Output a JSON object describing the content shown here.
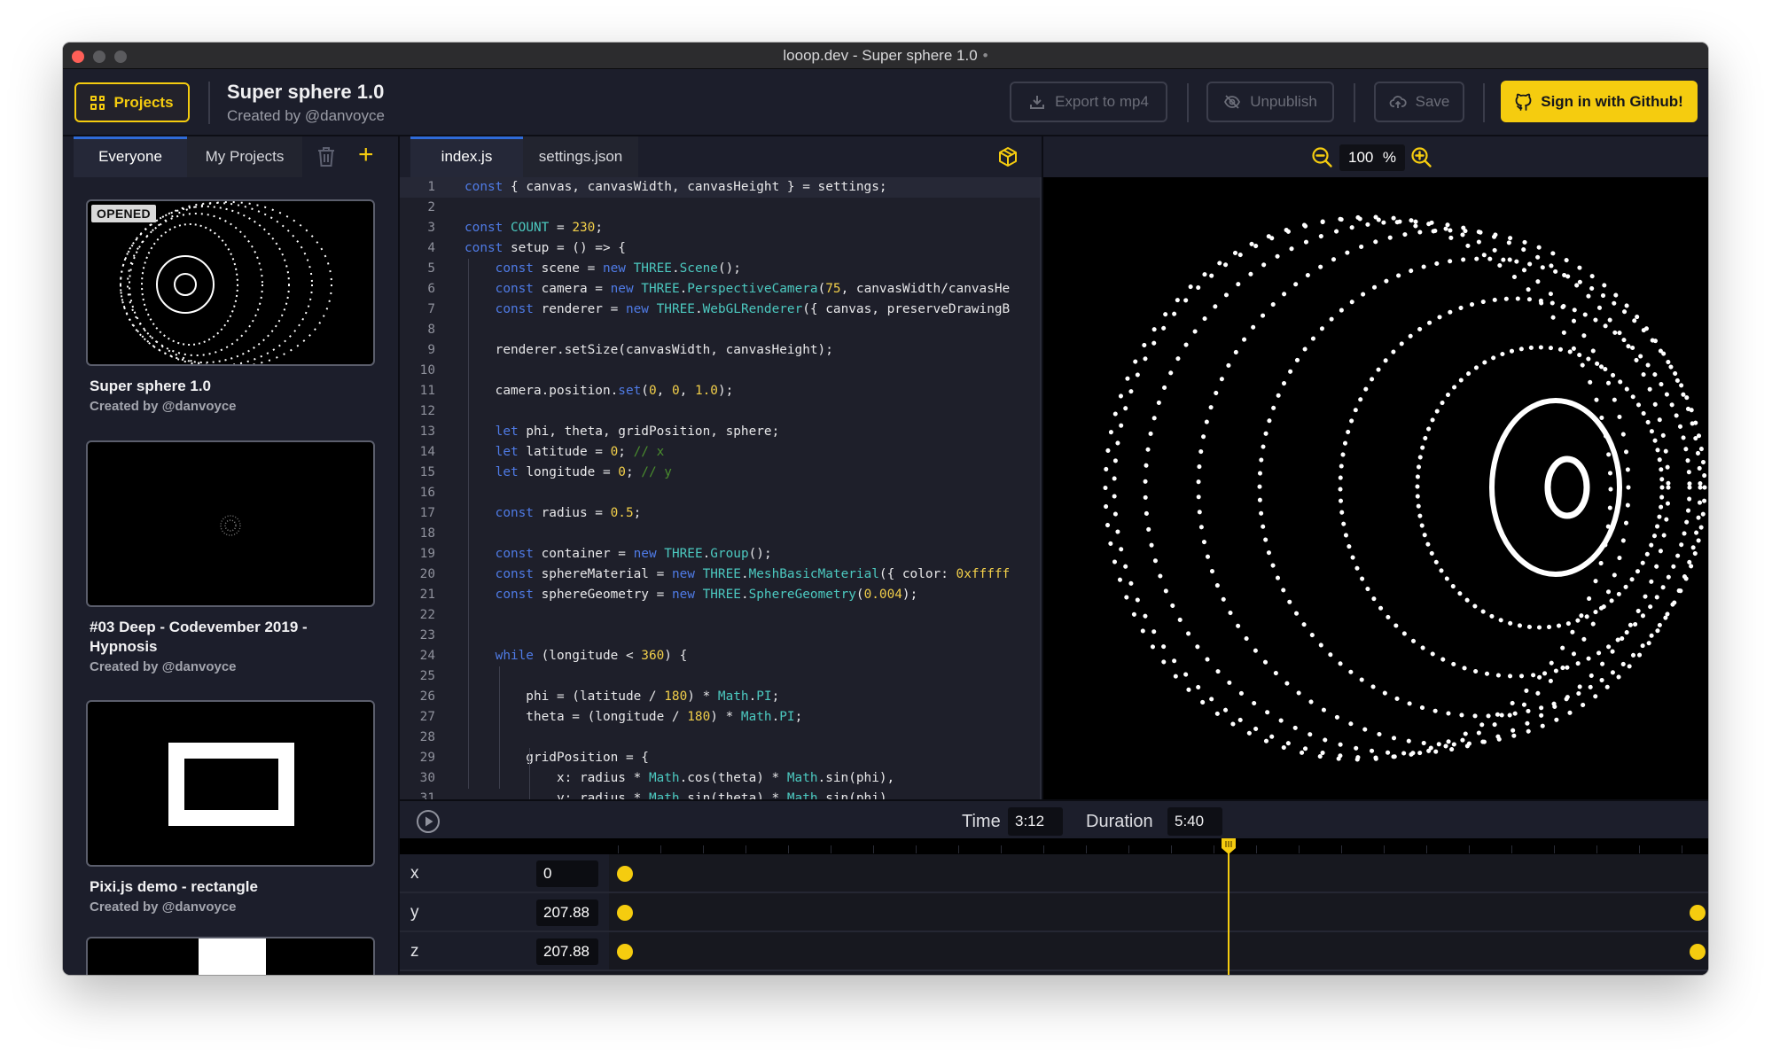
{
  "window": {
    "title": "looop.dev - Super sphere 1.0",
    "title_dot": "•"
  },
  "header": {
    "projects_label": "Projects",
    "project_title": "Super sphere 1.0",
    "project_author": "Created by @danvoyce",
    "export_label": "Export to mp4",
    "unpublish_label": "Unpublish",
    "save_label": "Save",
    "github_label": "Sign in with Github!",
    "accent_color": "#f5cc0f"
  },
  "sidebar": {
    "tabs": [
      {
        "label": "Everyone",
        "active": true
      },
      {
        "label": "My Projects",
        "active": false
      }
    ],
    "icons": [
      "trash-icon",
      "plus-icon"
    ],
    "projects": [
      {
        "title": "Super sphere 1.0",
        "author": "Created by @danvoyce",
        "badge": "OPENED"
      },
      {
        "title": "#03 Deep - Codevember 2019 - Hypnosis",
        "author": "Created by @danvoyce"
      },
      {
        "title": "Pixi.js demo - rectangle",
        "author": "Created by @danvoyce"
      }
    ]
  },
  "editor": {
    "tabs": [
      {
        "label": "index.js",
        "active": true
      },
      {
        "label": "settings.json",
        "active": false
      }
    ],
    "lines": [
      [
        [
          "k",
          "const"
        ],
        [
          "p",
          " { canvas, canvasWidth, canvasHeight } = settings;"
        ]
      ],
      [],
      [
        [
          "k",
          "const"
        ],
        [
          "p",
          " "
        ],
        [
          "t",
          "COUNT"
        ],
        [
          "p",
          " = "
        ],
        [
          "n",
          "230"
        ],
        [
          "p",
          ";"
        ]
      ],
      [
        [
          "k",
          "const"
        ],
        [
          "p",
          " setup = () => {"
        ]
      ],
      [
        [
          "p",
          "    "
        ],
        [
          "k",
          "const"
        ],
        [
          "p",
          " scene = "
        ],
        [
          "k",
          "new"
        ],
        [
          "p",
          " "
        ],
        [
          "t",
          "THREE"
        ],
        [
          "p",
          "."
        ],
        [
          "t",
          "Scene"
        ],
        [
          "p",
          "();"
        ]
      ],
      [
        [
          "p",
          "    "
        ],
        [
          "k",
          "const"
        ],
        [
          "p",
          " camera = "
        ],
        [
          "k",
          "new"
        ],
        [
          "p",
          " "
        ],
        [
          "t",
          "THREE"
        ],
        [
          "p",
          "."
        ],
        [
          "t",
          "PerspectiveCamera"
        ],
        [
          "p",
          "("
        ],
        [
          "n",
          "75"
        ],
        [
          "p",
          ", canvasWidth/canvasHe"
        ]
      ],
      [
        [
          "p",
          "    "
        ],
        [
          "k",
          "const"
        ],
        [
          "p",
          " renderer = "
        ],
        [
          "k",
          "new"
        ],
        [
          "p",
          " "
        ],
        [
          "t",
          "THREE"
        ],
        [
          "p",
          "."
        ],
        [
          "t",
          "WebGLRenderer"
        ],
        [
          "p",
          "({ canvas, preserveDrawingB"
        ]
      ],
      [],
      [
        [
          "p",
          "    renderer.setSize(canvasWidth, canvasHeight);"
        ]
      ],
      [],
      [
        [
          "p",
          "    camera.position."
        ],
        [
          "k",
          "set"
        ],
        [
          "p",
          "("
        ],
        [
          "n",
          "0"
        ],
        [
          "p",
          ", "
        ],
        [
          "n",
          "0"
        ],
        [
          "p",
          ", "
        ],
        [
          "n",
          "1.0"
        ],
        [
          "p",
          ");"
        ]
      ],
      [],
      [
        [
          "p",
          "    "
        ],
        [
          "k",
          "let"
        ],
        [
          "p",
          " phi, theta, gridPosition, sphere;"
        ]
      ],
      [
        [
          "p",
          "    "
        ],
        [
          "k",
          "let"
        ],
        [
          "p",
          " latitude = "
        ],
        [
          "n",
          "0"
        ],
        [
          "p",
          "; "
        ],
        [
          "c",
          "// x"
        ]
      ],
      [
        [
          "p",
          "    "
        ],
        [
          "k",
          "let"
        ],
        [
          "p",
          " longitude = "
        ],
        [
          "n",
          "0"
        ],
        [
          "p",
          "; "
        ],
        [
          "c",
          "// y"
        ]
      ],
      [],
      [
        [
          "p",
          "    "
        ],
        [
          "k",
          "const"
        ],
        [
          "p",
          " radius = "
        ],
        [
          "n",
          "0.5"
        ],
        [
          "p",
          ";"
        ]
      ],
      [],
      [
        [
          "p",
          "    "
        ],
        [
          "k",
          "const"
        ],
        [
          "p",
          " container = "
        ],
        [
          "k",
          "new"
        ],
        [
          "p",
          " "
        ],
        [
          "t",
          "THREE"
        ],
        [
          "p",
          "."
        ],
        [
          "t",
          "Group"
        ],
        [
          "p",
          "();"
        ]
      ],
      [
        [
          "p",
          "    "
        ],
        [
          "k",
          "const"
        ],
        [
          "p",
          " sphereMaterial = "
        ],
        [
          "k",
          "new"
        ],
        [
          "p",
          " "
        ],
        [
          "t",
          "THREE"
        ],
        [
          "p",
          "."
        ],
        [
          "t",
          "MeshBasicMaterial"
        ],
        [
          "p",
          "({ color: "
        ],
        [
          "n",
          "0xfffff"
        ]
      ],
      [
        [
          "p",
          "    "
        ],
        [
          "k",
          "const"
        ],
        [
          "p",
          " sphereGeometry = "
        ],
        [
          "k",
          "new"
        ],
        [
          "p",
          " "
        ],
        [
          "t",
          "THREE"
        ],
        [
          "p",
          "."
        ],
        [
          "t",
          "SphereGeometry"
        ],
        [
          "p",
          "("
        ],
        [
          "n",
          "0.004"
        ],
        [
          "p",
          ");"
        ]
      ],
      [],
      [],
      [
        [
          "p",
          "    "
        ],
        [
          "k",
          "while"
        ],
        [
          "p",
          " (longitude < "
        ],
        [
          "n",
          "360"
        ],
        [
          "p",
          ") {"
        ]
      ],
      [],
      [
        [
          "p",
          "        phi = (latitude / "
        ],
        [
          "n",
          "180"
        ],
        [
          "p",
          ") * "
        ],
        [
          "t",
          "Math"
        ],
        [
          "p",
          "."
        ],
        [
          "t",
          "PI"
        ],
        [
          "p",
          ";"
        ]
      ],
      [
        [
          "p",
          "        theta = (longitude / "
        ],
        [
          "n",
          "180"
        ],
        [
          "p",
          ") * "
        ],
        [
          "t",
          "Math"
        ],
        [
          "p",
          "."
        ],
        [
          "t",
          "PI"
        ],
        [
          "p",
          ";"
        ]
      ],
      [],
      [
        [
          "p",
          "        gridPosition = {"
        ]
      ],
      [
        [
          "p",
          "            x: radius * "
        ],
        [
          "t",
          "Math"
        ],
        [
          "p",
          ".cos(theta) * "
        ],
        [
          "t",
          "Math"
        ],
        [
          "p",
          ".sin(phi),"
        ]
      ],
      [
        [
          "p",
          "            y: radius * "
        ],
        [
          "t",
          "Math"
        ],
        [
          "p",
          ".sin(theta) * "
        ],
        [
          "t",
          "Math"
        ],
        [
          "p",
          ".sin(phi)"
        ]
      ]
    ]
  },
  "preview": {
    "zoom_value": "100",
    "zoom_unit": "%"
  },
  "timeline": {
    "time_label": "Time",
    "time_value": "3:12",
    "duration_label": "Duration",
    "duration_value": "5:40",
    "playhead_fraction": 0.564,
    "tracks": [
      {
        "name": "x",
        "value": "0",
        "keyframes": [
          0.0
        ]
      },
      {
        "name": "y",
        "value": "207.88",
        "keyframes": [
          0.0,
          1.0
        ]
      },
      {
        "name": "z",
        "value": "207.88",
        "keyframes": [
          0.0,
          1.0
        ]
      }
    ]
  }
}
